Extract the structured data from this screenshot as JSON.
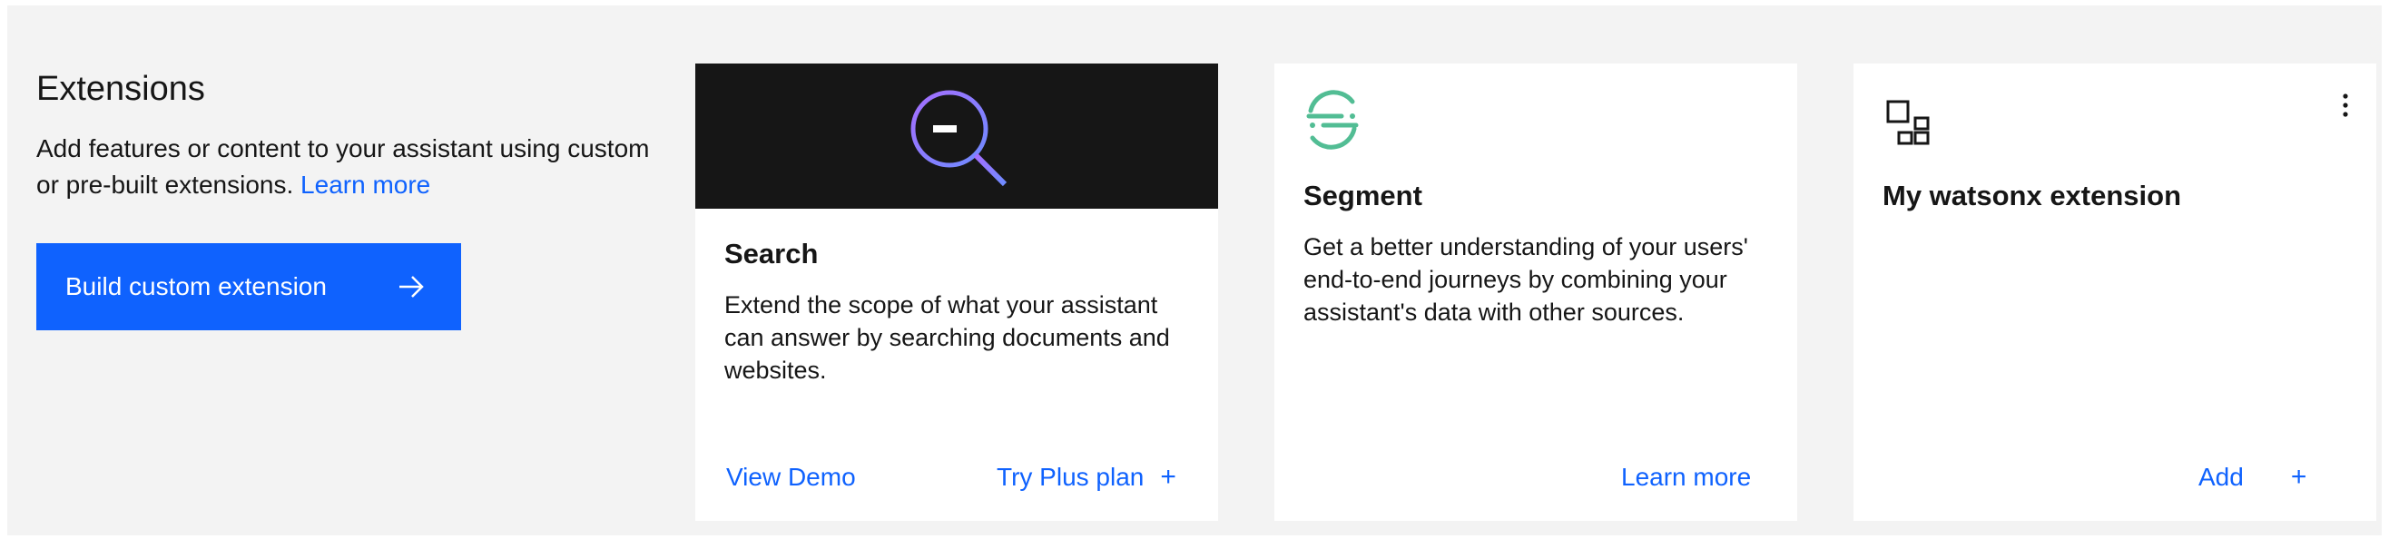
{
  "intro": {
    "title": "Extensions",
    "description": "Add features or content to your assistant using custom or pre-built extensions.",
    "learn_more": "Learn more",
    "build_button": "Build custom extension"
  },
  "cards": {
    "search": {
      "title": "Search",
      "description": "Extend the scope of what your assistant can answer by searching documents and websites.",
      "view_demo": "View Demo",
      "try_plus": "Try Plus plan",
      "icon": "search-magnifier-icon"
    },
    "segment": {
      "title": "Segment",
      "description": "Get a better understanding of your users' end-to-end journeys by combining your assistant's data with other sources.",
      "learn_more": "Learn more",
      "icon": "segment-logo-icon"
    },
    "custom": {
      "title": "My watsonx extension",
      "add": "Add",
      "icon": "app-grid-icon"
    }
  },
  "colors": {
    "accent": "#0f62fe",
    "panel_bg": "#f3f3f3",
    "banner_bg": "#161616",
    "segment_green": "#52bd94",
    "search_purple": "#8a7cf8"
  }
}
